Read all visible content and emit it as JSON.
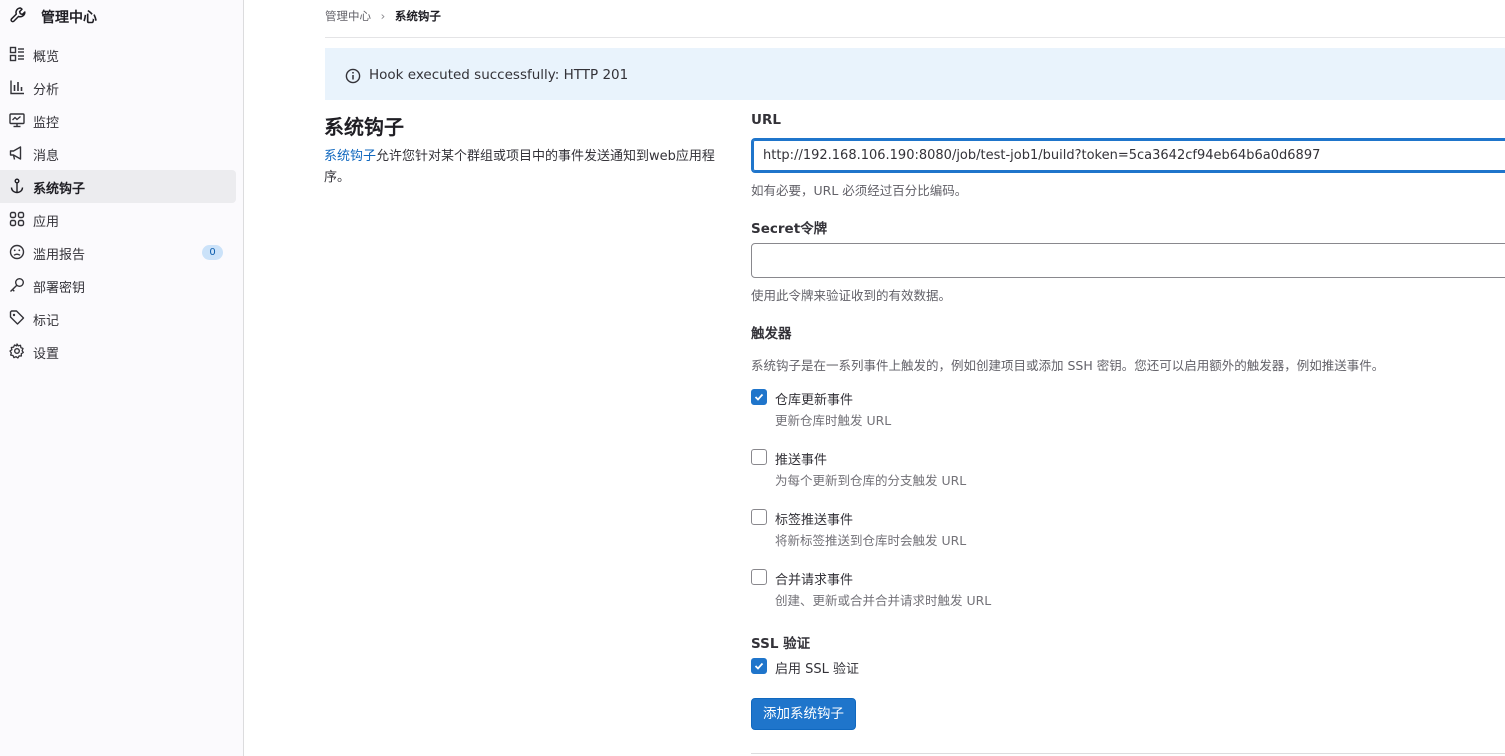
{
  "sidebar": {
    "title": "管理中心",
    "items": [
      {
        "label": "概览",
        "icon": "overview-icon"
      },
      {
        "label": "分析",
        "icon": "analytics-icon"
      },
      {
        "label": "监控",
        "icon": "monitor-icon"
      },
      {
        "label": "消息",
        "icon": "messages-icon"
      },
      {
        "label": "系统钩子",
        "icon": "hook-icon",
        "active": true
      },
      {
        "label": "应用",
        "icon": "applications-icon"
      },
      {
        "label": "滥用报告",
        "icon": "abuse-icon",
        "badge": "0"
      },
      {
        "label": "部署密钥",
        "icon": "key-icon"
      },
      {
        "label": "标记",
        "icon": "label-icon"
      },
      {
        "label": "设置",
        "icon": "settings-icon"
      }
    ]
  },
  "breadcrumb": {
    "parent": "管理中心",
    "current": "系统钩子"
  },
  "alert": {
    "text": "Hook executed successfully: HTTP 201"
  },
  "page": {
    "title": "系统钩子",
    "desc_link": "系统钩子",
    "desc_rest": "允许您针对某个群组或项目中的事件发送通知到web应用程序。"
  },
  "form": {
    "url_label": "URL",
    "url_value": "http://192.168.106.190:8080/job/test-job1/build?token=5ca3642cf94eb64b6a0d6897",
    "url_help": "如有必要，URL 必须经过百分比编码。",
    "secret_label": "Secret令牌",
    "secret_value": "",
    "secret_help": "使用此令牌来验证收到的有效数据。",
    "triggers_label": "触发器",
    "triggers_help": "系统钩子是在一系列事件上触发的，例如创建项目或添加 SSH 密钥。您还可以启用额外的触发器，例如推送事件。",
    "triggers": [
      {
        "label": "仓库更新事件",
        "help": "更新仓库时触发 URL",
        "checked": true
      },
      {
        "label": "推送事件",
        "help": "为每个更新到仓库的分支触发 URL",
        "checked": false
      },
      {
        "label": "标签推送事件",
        "help": "将新标签推送到仓库时会触发 URL",
        "checked": false
      },
      {
        "label": "合并请求事件",
        "help": "创建、更新或合并合并请求时触发 URL",
        "checked": false
      }
    ],
    "ssl_label": "SSL 验证",
    "ssl_checkbox_label": "启用 SSL 验证",
    "ssl_checked": true,
    "submit_label": "添加系统钩子"
  },
  "colors": {
    "accent": "#1f75cb",
    "link": "#1068bf",
    "alert_bg": "#e9f3fc",
    "active_item_bg": "#ececef"
  }
}
